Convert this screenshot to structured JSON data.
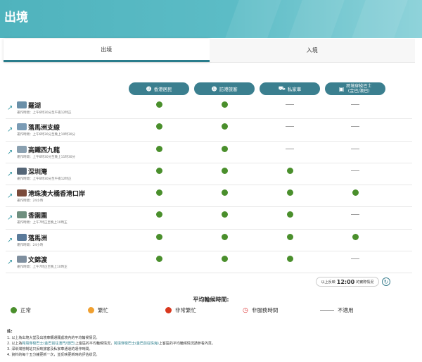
{
  "header": {
    "title": "出境"
  },
  "tabs": [
    {
      "label": "出境",
      "active": true
    },
    {
      "label": "入境",
      "active": false
    }
  ],
  "columns": [
    {
      "label": "香港居民",
      "icon": "person-icon"
    },
    {
      "label": "訪港旅客",
      "icon": "person-icon"
    },
    {
      "label": "私家車",
      "icon": "car-icon"
    },
    {
      "label": "跨境穿梭巴士\n(金巴/澳巴)",
      "icon": "bus-icon"
    }
  ],
  "rows": [
    {
      "name": "羅湖",
      "hours": "運作時間：上午6時30分至午夜12時正",
      "status": [
        "green",
        "green",
        "na",
        "na"
      ]
    },
    {
      "name": "落馬洲支線",
      "hours": "運作時間：上午6時30分至晚上10時30分",
      "status": [
        "green",
        "green",
        "na",
        "na"
      ]
    },
    {
      "name": "高鐵西九龍",
      "hours": "運作時間：上午6時30分至晚上11時30分",
      "status": [
        "green",
        "green",
        "na",
        "na"
      ]
    },
    {
      "name": "深圳灣",
      "hours": "運作時間：上午6時30分至午夜12時正",
      "status": [
        "green",
        "green",
        "green",
        "na"
      ]
    },
    {
      "name": "港珠澳大橋香港口岸",
      "hours": "運作時間：24小時",
      "status": [
        "green",
        "green",
        "green",
        "green"
      ]
    },
    {
      "name": "香園圍",
      "hours": "運作時間：上午7時正至晚上10時正",
      "status": [
        "green",
        "green",
        "green",
        "na"
      ]
    },
    {
      "name": "落馬洲",
      "hours": "運作時間：24小時",
      "status": [
        "green",
        "green",
        "green",
        "green"
      ]
    },
    {
      "name": "文錦渡",
      "hours": "運作時間：上午7時正至晚上10時正",
      "status": [
        "green",
        "green",
        "green",
        "na"
      ]
    }
  ],
  "update": {
    "prefix": "以上反映",
    "time": "12:00",
    "suffix": "的實際情況"
  },
  "legend": {
    "title": "平均輪候時間:",
    "items": [
      {
        "label": "正常",
        "color": "#4a8f2c",
        "kind": "dot"
      },
      {
        "label": "繁忙",
        "color": "#f0a030",
        "kind": "dot"
      },
      {
        "label": "非常繁忙",
        "color": "#d9381e",
        "kind": "dot"
      },
      {
        "label": "非服務時間",
        "kind": "clock"
      },
      {
        "label": "不適用",
        "kind": "dash"
      }
    ]
  },
  "notes": {
    "heading": "註:",
    "items": [
      "1. 以上為出境大堂及出境車輛通關處境內的平均輪候情況。",
      "2. 以上為",
      "3. 深圳灣管制站只反映旅客及私家車通道的運作時間。",
      "4. 資料的每十五分鐘更新一次，並反映更新時的評估狀況。"
    ],
    "note2": {
      "a": "2. 以上為",
      "b": "跨境穿梭巴士(金巴前往澳門/澳巴)",
      "c": "上客區的平均輪候情況，",
      "d": "跨境穿梭巴士(金巴前往珠海)",
      "e": "上客區的平均輪候情況請參看內頁。"
    }
  },
  "colors": {
    "green": "#4a8f2c",
    "accent": "#3b7f8f"
  }
}
